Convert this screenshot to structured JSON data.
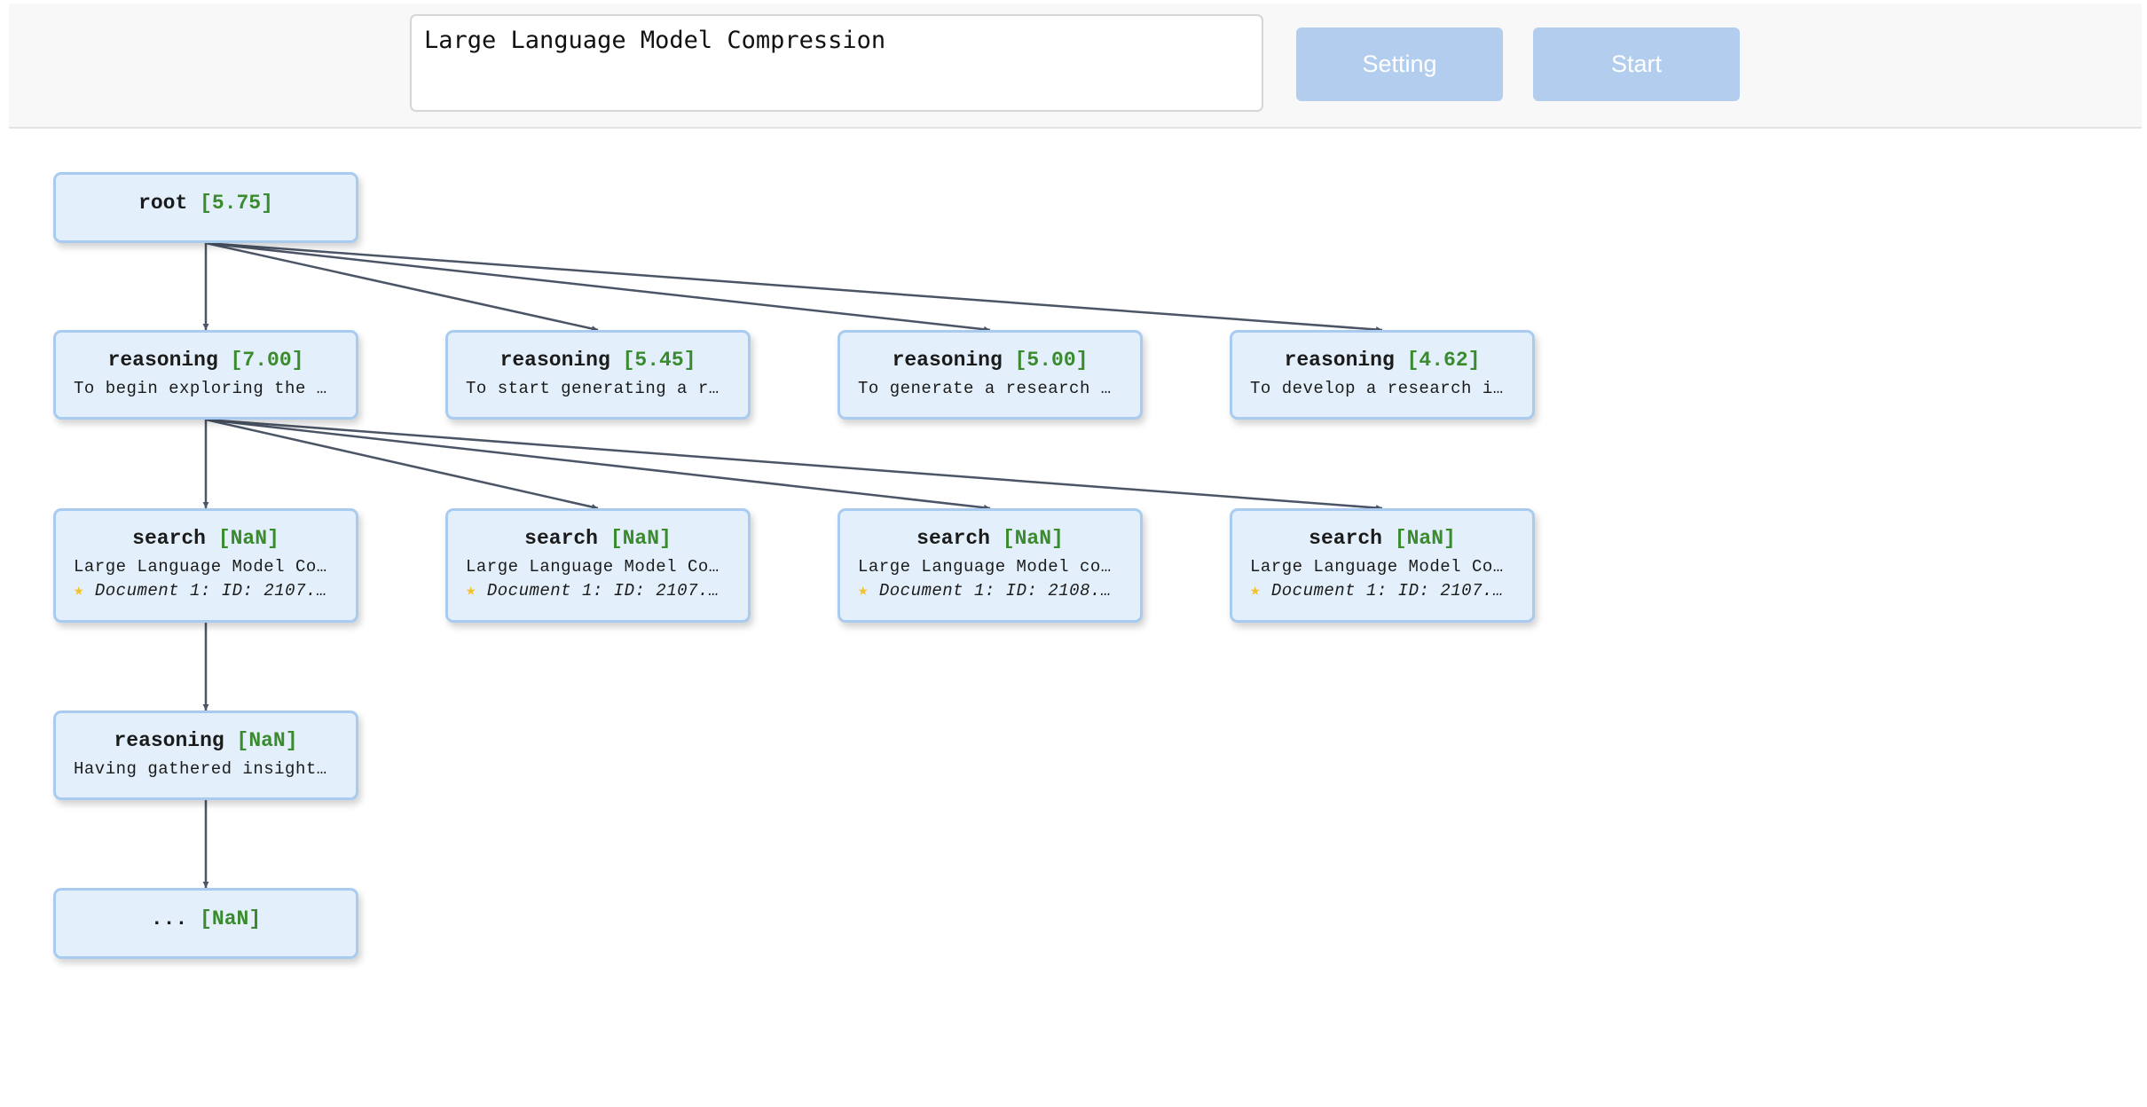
{
  "query": {
    "value": "Large Language Model Compression"
  },
  "buttons": {
    "setting": "Setting",
    "start": "Start"
  },
  "tree": {
    "nodes": [
      {
        "id": "root",
        "type": "root",
        "score": "[5.75]"
      },
      {
        "id": "r1",
        "type": "reasoning",
        "score": "[7.00]",
        "text": "To begin exploring the …",
        "parent": "root"
      },
      {
        "id": "r2",
        "type": "reasoning",
        "score": "[5.45]",
        "text": "To start generating a r…",
        "parent": "root"
      },
      {
        "id": "r3",
        "type": "reasoning",
        "score": "[5.00]",
        "text": "To generate a research …",
        "parent": "root"
      },
      {
        "id": "r4",
        "type": "reasoning",
        "score": "[4.62]",
        "text": "To develop a research i…",
        "parent": "root"
      },
      {
        "id": "s1",
        "type": "search",
        "score": "[NaN]",
        "text": "Large Language Model Co…",
        "doc": "Document 1: ID: 2107.…",
        "parent": "r1"
      },
      {
        "id": "s2",
        "type": "search",
        "score": "[NaN]",
        "text": "Large Language Model Co…",
        "doc": "Document 1: ID: 2107.…",
        "parent": "r1"
      },
      {
        "id": "s3",
        "type": "search",
        "score": "[NaN]",
        "text": "Large Language Model co…",
        "doc": "Document 1: ID: 2108.…",
        "parent": "r1"
      },
      {
        "id": "s4",
        "type": "search",
        "score": "[NaN]",
        "text": "Large Language Model Co…",
        "doc": "Document 1: ID: 2107.…",
        "parent": "r1"
      },
      {
        "id": "r5",
        "type": "reasoning",
        "score": "[NaN]",
        "text": "Having gathered insight…",
        "parent": "s1"
      },
      {
        "id": "more",
        "type": "...",
        "score": "[NaN]",
        "parent": "r5"
      }
    ]
  },
  "colors": {
    "edge": "#4b5566",
    "score": "#3a8a2e",
    "node_bg": "#e3f0fb",
    "node_border": "#a9cbef",
    "button": "#b3cdef"
  },
  "icons": {
    "doc_star": "star-icon"
  }
}
